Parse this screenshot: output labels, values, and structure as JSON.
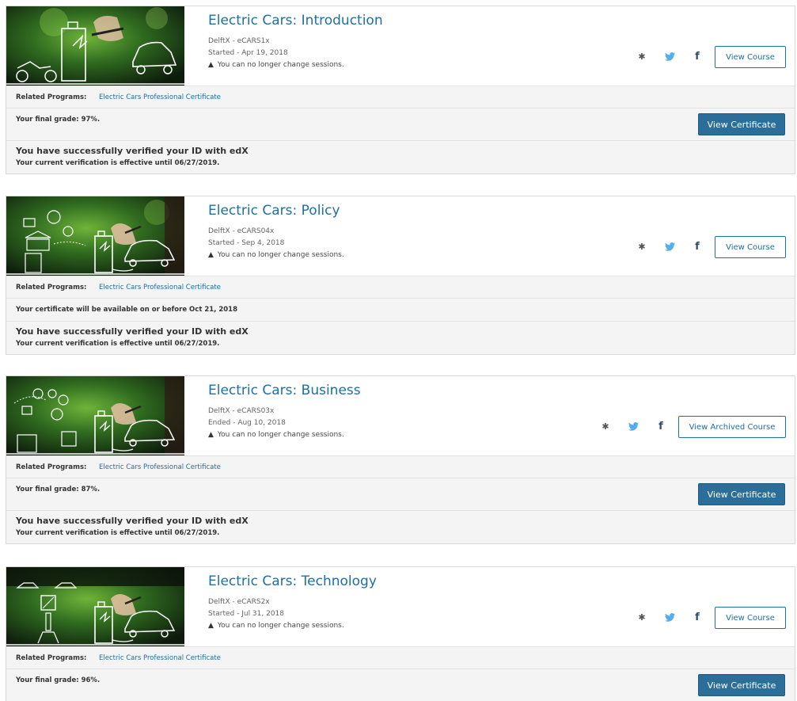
{
  "colors": {
    "link": "#1e6fa3",
    "certificate_button": "#2a6e99",
    "row_background": "#f4f4f4"
  },
  "icons": {
    "settings": "gear-icon",
    "twitter": "twitter-icon",
    "facebook": "facebook-icon",
    "warning": "warning-icon"
  },
  "courses": [
    {
      "title": "Electric Cars: Introduction",
      "org_code": "DelftX - eCARS1x",
      "date": "Started - Apr 19, 2018",
      "session_note": "You can no longer change sessions.",
      "course_button": "View Course",
      "related_label": "Related Programs:",
      "program_link": "Electric Cars Professional Certificate",
      "status_text": "Your final grade: 97%.",
      "certificate_button": "View Certificate",
      "verify_title": "You have successfully verified your ID with edX",
      "verify_sub": "Your current verification is effective until 06/27/2019."
    },
    {
      "title": "Electric Cars: Policy",
      "org_code": "DelftX - eCARS04x",
      "date": "Started - Sep 4, 2018",
      "session_note": "You can no longer change sessions.",
      "course_button": "View Course",
      "related_label": "Related Programs:",
      "program_link": "Electric Cars Professional Certificate",
      "status_text": "Your certificate will be available on or before Oct 21, 2018",
      "verify_title": "You have successfully verified your ID with edX",
      "verify_sub": "Your current verification is effective until 06/27/2019."
    },
    {
      "title": "Electric Cars: Business",
      "org_code": "DelftX - eCARS03x",
      "date": "Ended - Aug 10, 2018",
      "session_note": "You can no longer change sessions.",
      "course_button": "View Archived Course",
      "related_label": "Related Programs:",
      "program_link": "Electric Cars Professional Certificate",
      "status_text": "Your final grade: 87%.",
      "certificate_button": "View Certificate",
      "verify_title": "You have successfully verified your ID with edX",
      "verify_sub": "Your current verification is effective until 06/27/2019."
    },
    {
      "title": "Electric Cars: Technology",
      "org_code": "DelftX - eCARS2x",
      "date": "Started - Jul 31, 2018",
      "session_note": "You can no longer change sessions.",
      "course_button": "View Course",
      "related_label": "Related Programs:",
      "program_link": "Electric Cars Professional Certificate",
      "status_text": "Your final grade: 96%.",
      "certificate_button": "View Certificate"
    }
  ]
}
